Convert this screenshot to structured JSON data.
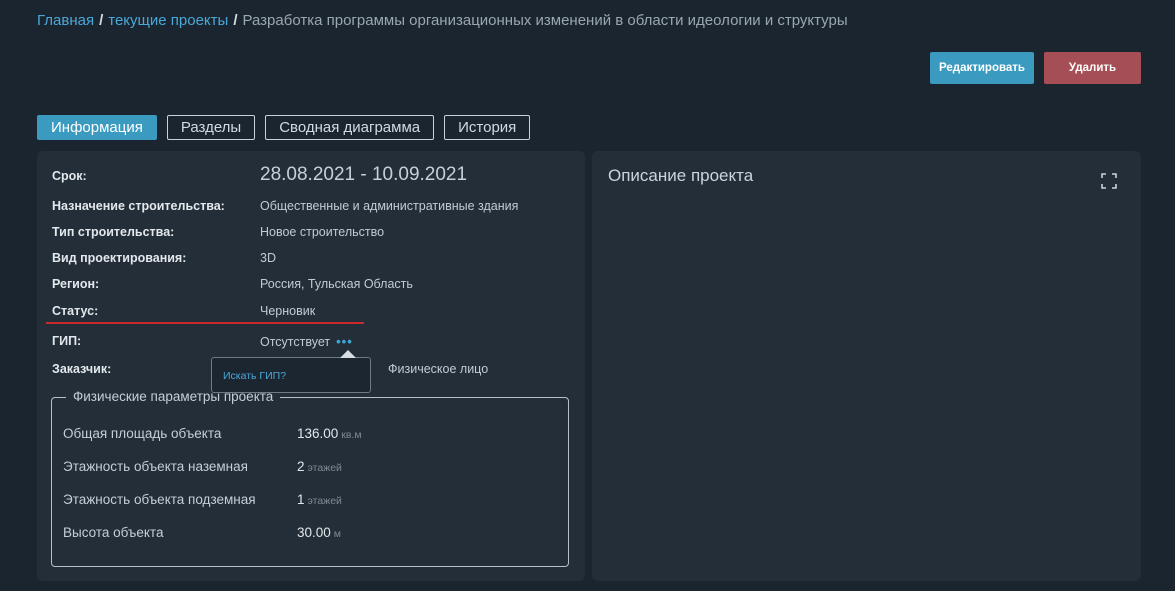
{
  "breadcrumb": {
    "home": "Главная",
    "projects": "текущие проекты",
    "separator": "/",
    "current": "Разработка программы организационных изменений в области идеологии и структуры"
  },
  "actions": {
    "edit": "Редактировать",
    "delete": "Удалить"
  },
  "tabs": [
    "Информация",
    "Разделы",
    "Сводная диаграмма",
    "История"
  ],
  "info": {
    "term_label": "Срок:",
    "term_value": "28.08.2021 - 10.09.2021",
    "purpose_label": "Назначение строительства:",
    "purpose_value": "Общественные и административные здания",
    "type_label": "Тип строительства:",
    "type_value": "Новое строительство",
    "design_label": "Вид проектирования:",
    "design_value": "3D",
    "region_label": "Регион:",
    "region_value": "Россия, Тульская Область",
    "status_label": "Статус:",
    "status_value": "Черновик",
    "gip_label": "ГИП:",
    "gip_value": "Отсутствует",
    "gip_more": "•••",
    "customer_label": "Заказчик:",
    "customer_value": "Физическое лицо"
  },
  "popover": {
    "link": "Искать ГИП?"
  },
  "physical": {
    "legend": "Физические параметры проекта",
    "rows": [
      {
        "label": "Общая площадь объекта",
        "value": "136.00",
        "unit": "кв.м"
      },
      {
        "label": "Этажность объекта наземная",
        "value": "2",
        "unit": "этажей"
      },
      {
        "label": "Этажность объекта подземная",
        "value": "1",
        "unit": "этажей"
      },
      {
        "label": "Высота объекта",
        "value": "30.00",
        "unit": "м"
      }
    ]
  },
  "description": {
    "title": "Описание проекта"
  },
  "colors": {
    "background": "#1b252f",
    "panel": "#232e39",
    "accent": "#3b9ac0",
    "danger": "#a54e55",
    "link": "#4aa8d8",
    "status_underline": "#cc2a2a"
  }
}
